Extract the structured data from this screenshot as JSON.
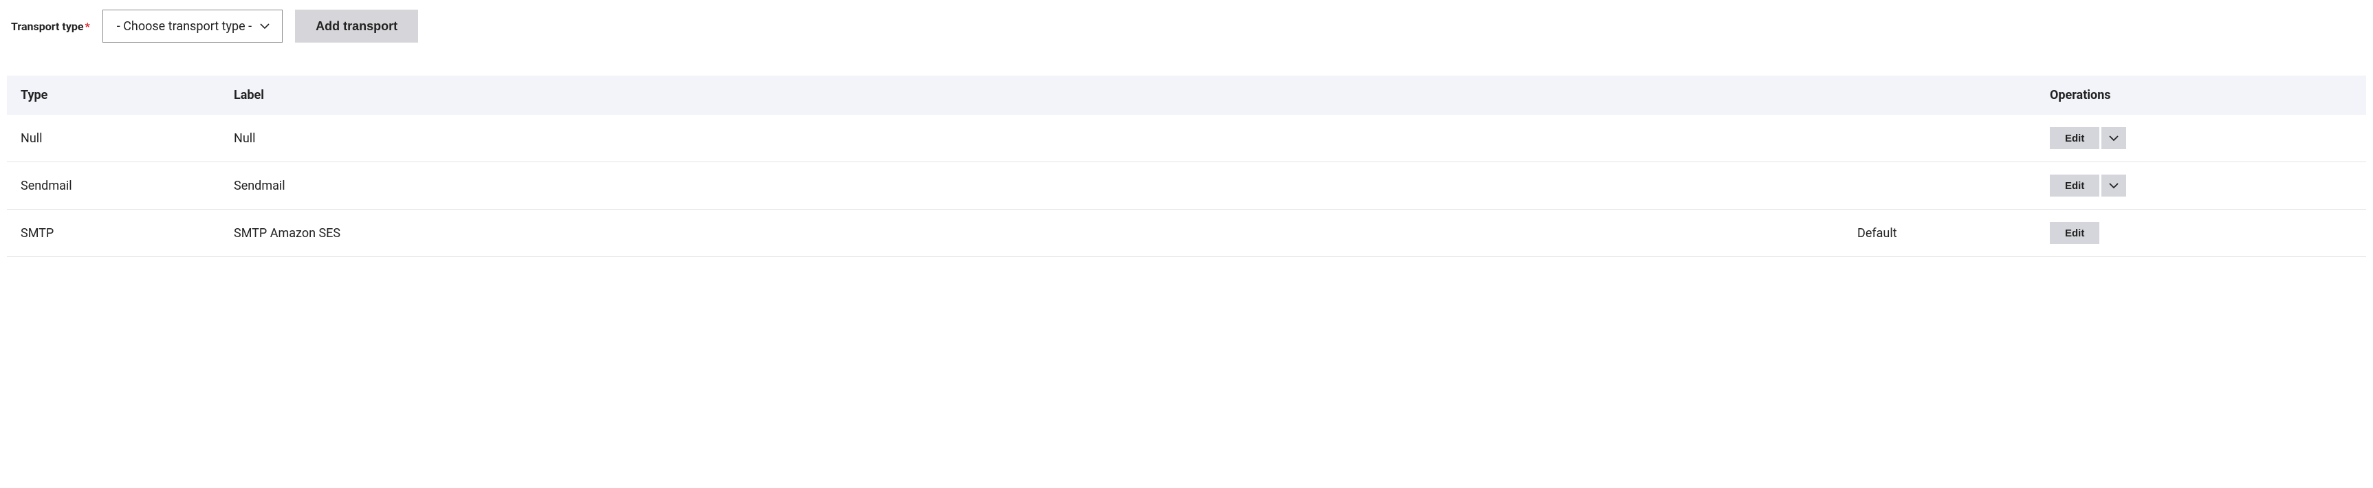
{
  "form": {
    "transport_type_label": "Transport type",
    "required_marker": "*",
    "select_placeholder": "- Choose transport type -",
    "add_button_label": "Add transport"
  },
  "table": {
    "headers": {
      "type": "Type",
      "label": "Label",
      "operations": "Operations"
    },
    "rows": [
      {
        "type": "Null",
        "label": "Null",
        "status": "",
        "edit_label": "Edit",
        "has_dropdown": true
      },
      {
        "type": "Sendmail",
        "label": "Sendmail",
        "status": "",
        "edit_label": "Edit",
        "has_dropdown": true
      },
      {
        "type": "SMTP",
        "label": "SMTP Amazon SES",
        "status": "Default",
        "edit_label": "Edit",
        "has_dropdown": false
      }
    ]
  }
}
